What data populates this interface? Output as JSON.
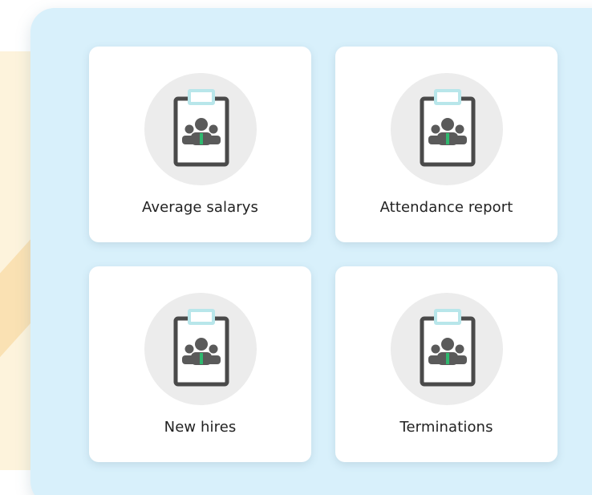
{
  "report_tiles": [
    {
      "label": "Average salarys",
      "icon": "clipboard-team-icon"
    },
    {
      "label": "Attendance report",
      "icon": "clipboard-team-icon"
    },
    {
      "label": "New hires",
      "icon": "clipboard-team-icon"
    },
    {
      "label": "Terminations",
      "icon": "clipboard-team-icon"
    }
  ],
  "colors": {
    "panel_background": "#d8f0fb",
    "card_background": "#ffffff",
    "icon_circle": "#ececec",
    "clipboard_frame": "#4a4a4a",
    "clipboard_clip": "#b8e6ea",
    "person_tie": "#2fb86f",
    "decor_peach": "#fdf3dc"
  }
}
